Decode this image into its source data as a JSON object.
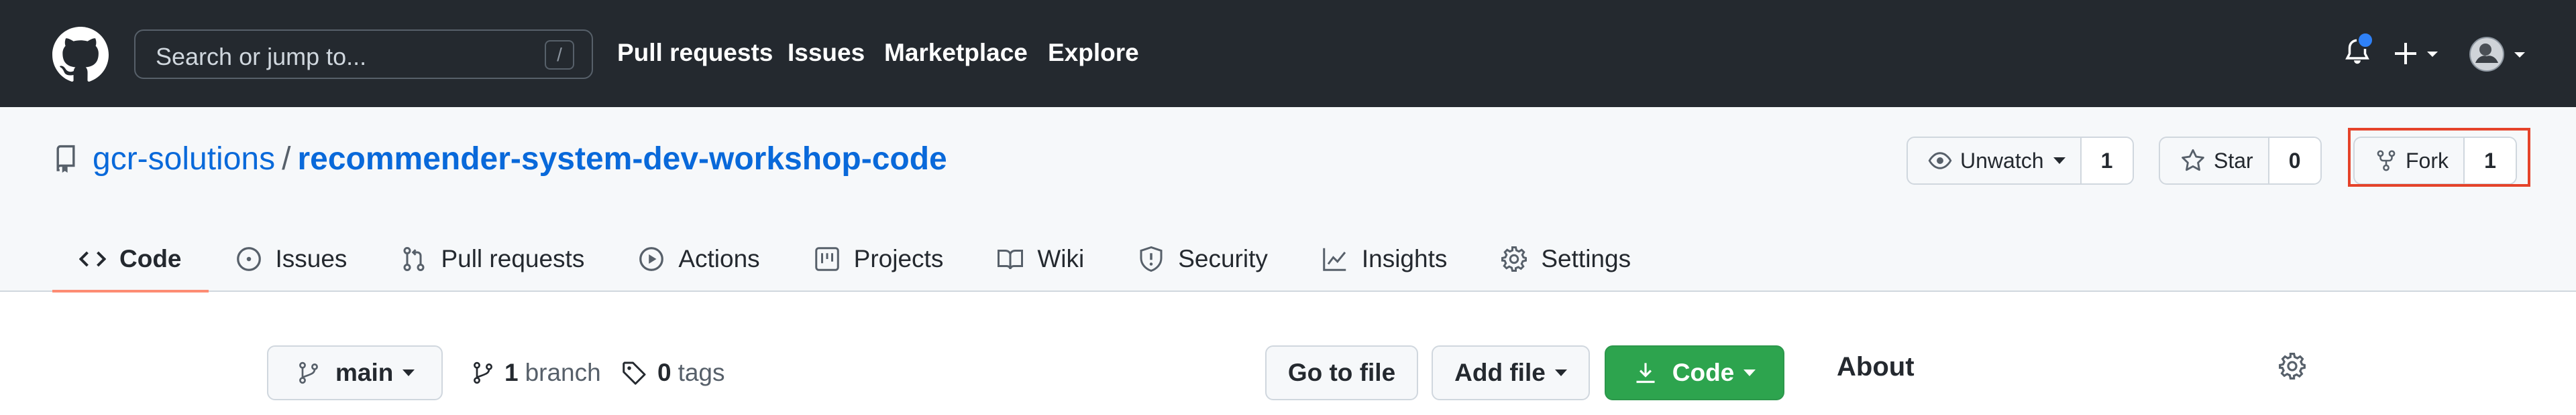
{
  "header": {
    "search_placeholder": "Search or jump to...",
    "search_shortcut": "/",
    "nav": [
      "Pull requests",
      "Issues",
      "Marketplace",
      "Explore"
    ]
  },
  "repo": {
    "owner": "gcr-solutions",
    "separator": "/",
    "name": "recommender-system-dev-workshop-code",
    "watch_label": "Unwatch",
    "watch_count": "1",
    "star_label": "Star",
    "star_count": "0",
    "fork_label": "Fork",
    "fork_count": "1"
  },
  "tabs": [
    {
      "label": "Code",
      "icon": "code-icon",
      "active": true
    },
    {
      "label": "Issues",
      "icon": "issue-opened-icon"
    },
    {
      "label": "Pull requests",
      "icon": "git-pull-request-icon"
    },
    {
      "label": "Actions",
      "icon": "play-icon"
    },
    {
      "label": "Projects",
      "icon": "project-icon"
    },
    {
      "label": "Wiki",
      "icon": "book-icon"
    },
    {
      "label": "Security",
      "icon": "shield-icon"
    },
    {
      "label": "Insights",
      "icon": "graph-icon"
    },
    {
      "label": "Settings",
      "icon": "gear-icon"
    }
  ],
  "main": {
    "branch": "main",
    "branches_count": "1",
    "branches_label": "branch",
    "tags_count": "0",
    "tags_label": "tags",
    "go_to_file": "Go to file",
    "add_file": "Add file",
    "code_button": "Code",
    "about_title": "About"
  },
  "colors": {
    "header_bg": "#24292f",
    "link_blue": "#0969da",
    "tab_underline": "#fd8c73",
    "code_button_green": "#2da44e",
    "highlight_red": "#e5432a",
    "notification_dot": "#2f81f7"
  }
}
